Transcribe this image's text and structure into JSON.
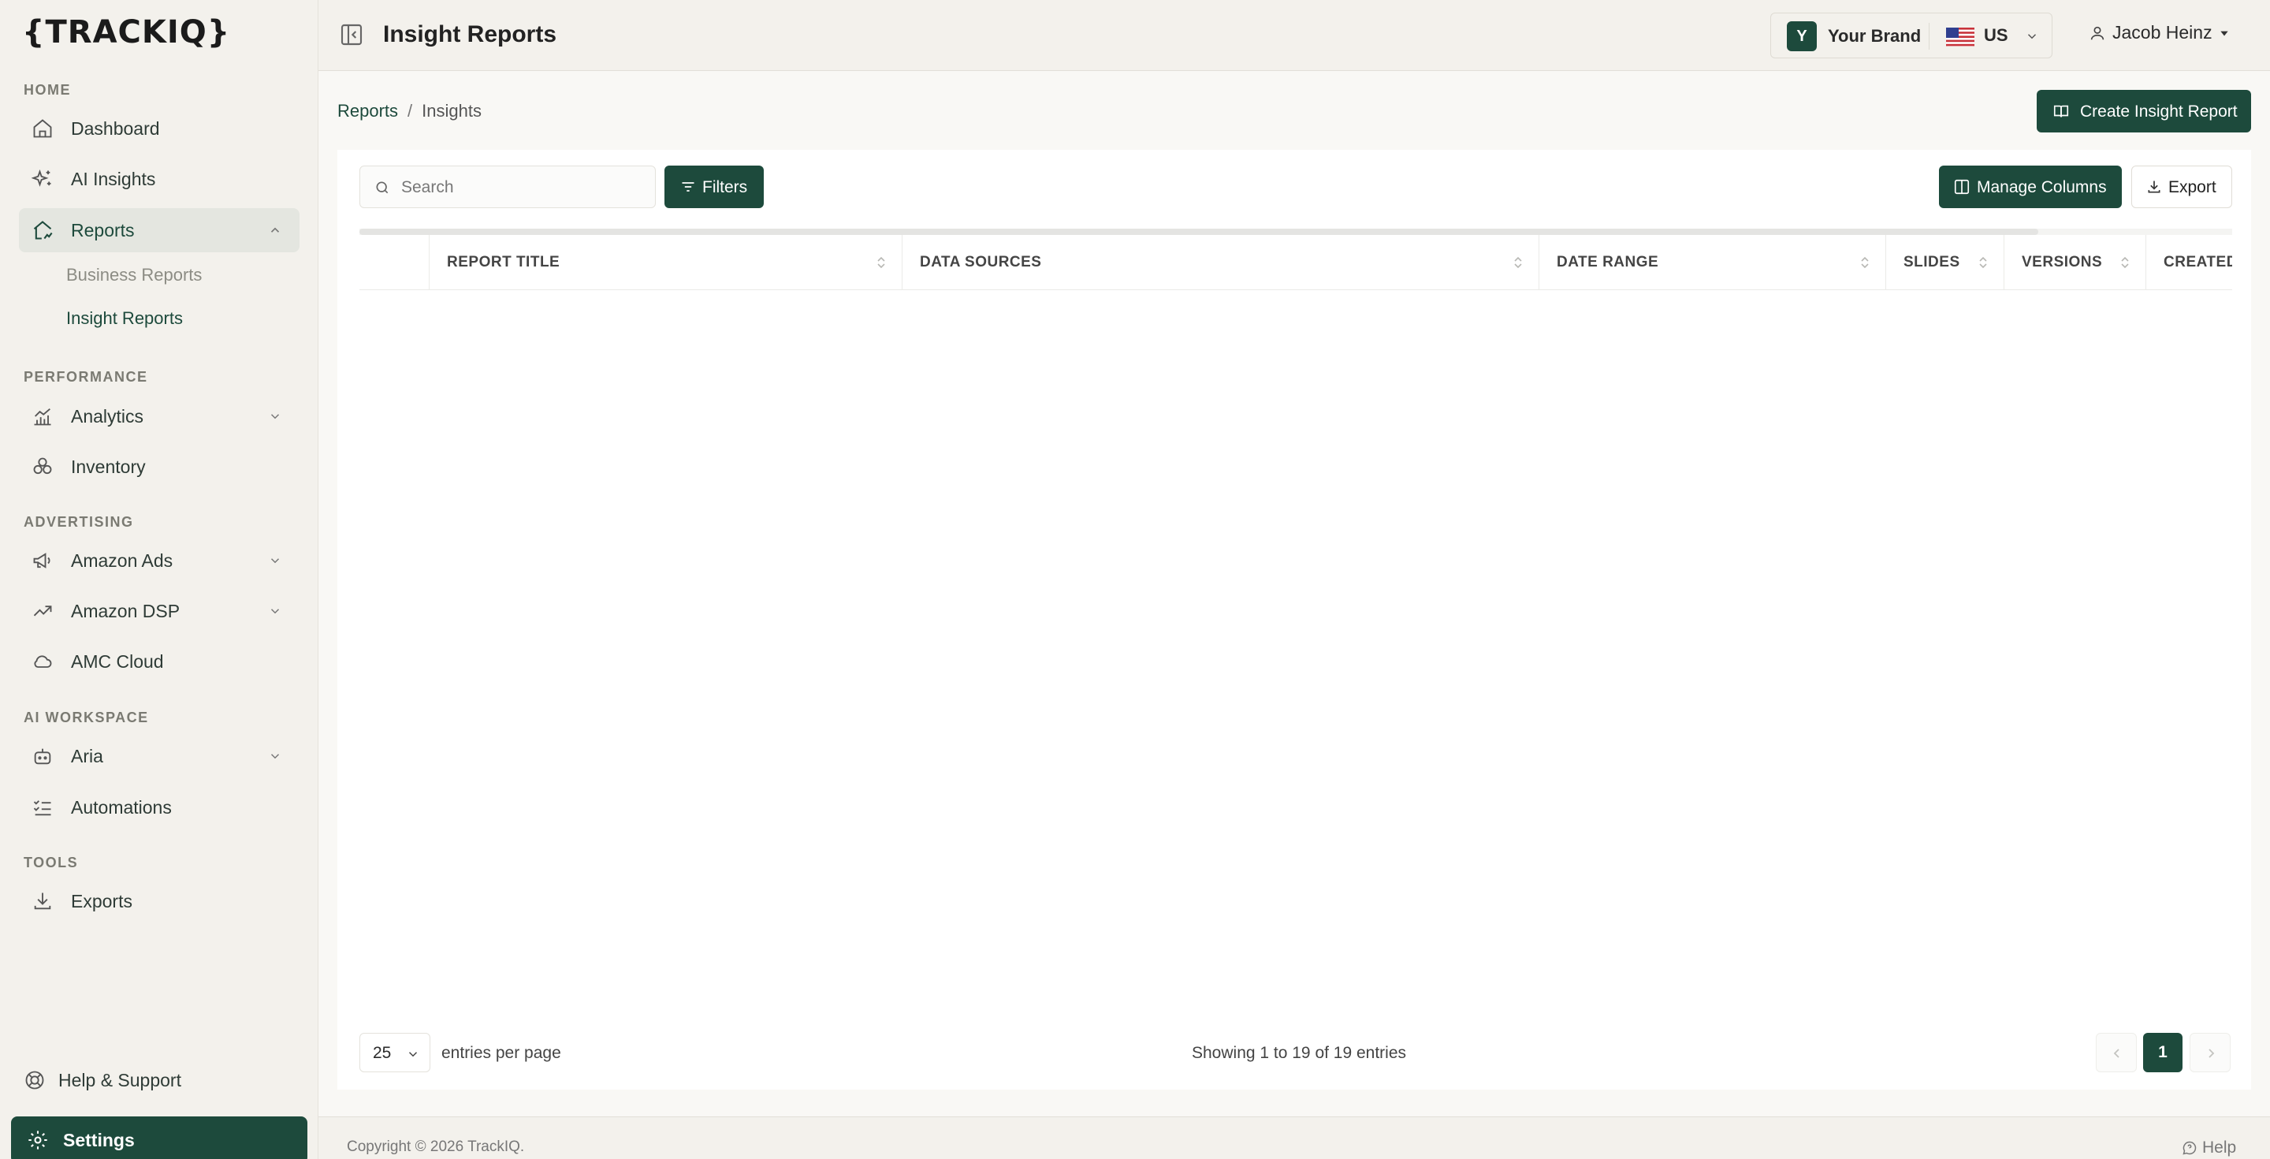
{
  "app": {
    "logo_text": "{TRACKIQ}"
  },
  "sidebar": {
    "sections": [
      {
        "label": "HOME"
      },
      {
        "label": "PERFORMANCE"
      },
      {
        "label": "ADVERTISING"
      },
      {
        "label": "AI WORKSPACE"
      },
      {
        "label": "TOOLS"
      }
    ],
    "items": [
      {
        "label": "Dashboard",
        "icon": "home-icon"
      },
      {
        "label": "AI Insights",
        "icon": "sparkle-icon"
      },
      {
        "label": "Reports",
        "icon": "reports-icon",
        "expanded": true
      },
      {
        "label": "Analytics",
        "icon": "analytics-icon"
      },
      {
        "label": "Inventory",
        "icon": "inventory-icon"
      },
      {
        "label": "Amazon Ads",
        "icon": "megaphone-icon"
      },
      {
        "label": "Amazon DSP",
        "icon": "trend-icon"
      },
      {
        "label": "AMC Cloud",
        "icon": "cloud-icon"
      },
      {
        "label": "Aria",
        "icon": "bot-icon"
      },
      {
        "label": "Automations",
        "icon": "checklist-icon"
      },
      {
        "label": "Exports",
        "icon": "download-icon"
      }
    ],
    "sub_items": [
      {
        "label": "Business Reports"
      },
      {
        "label": "Insight Reports",
        "current": true
      }
    ],
    "help_label": "Help & Support",
    "settings_label": "Settings"
  },
  "header": {
    "title": "Insight Reports",
    "brand": {
      "avatar_letter": "Y",
      "name": "Your Brand",
      "country": "US"
    },
    "user": {
      "name": "Jacob Heinz"
    }
  },
  "breadcrumb": {
    "parent": "Reports",
    "separator": "/",
    "current": "Insights"
  },
  "toolbar": {
    "create_label": "Create Insight Report",
    "search_placeholder": "Search",
    "filters_label": "Filters",
    "manage_columns_label": "Manage Columns",
    "export_label": "Export"
  },
  "table": {
    "columns": [
      "REPORT TITLE",
      "DATA SOURCES",
      "DATE RANGE",
      "SLIDES",
      "VERSIONS",
      "CREATED"
    ],
    "rows": []
  },
  "pagination": {
    "per_page": "25",
    "per_page_label": "entries per page",
    "showing_text": "Showing 1 to 19 of 19 entries",
    "current_page": "1"
  },
  "footer": {
    "copyright": "Copyright © 2026 TrackIQ.",
    "help_label": "Help"
  },
  "colors": {
    "accent": "#1d4a3c",
    "background": "#f3f1ec",
    "panel": "#ffffff"
  }
}
